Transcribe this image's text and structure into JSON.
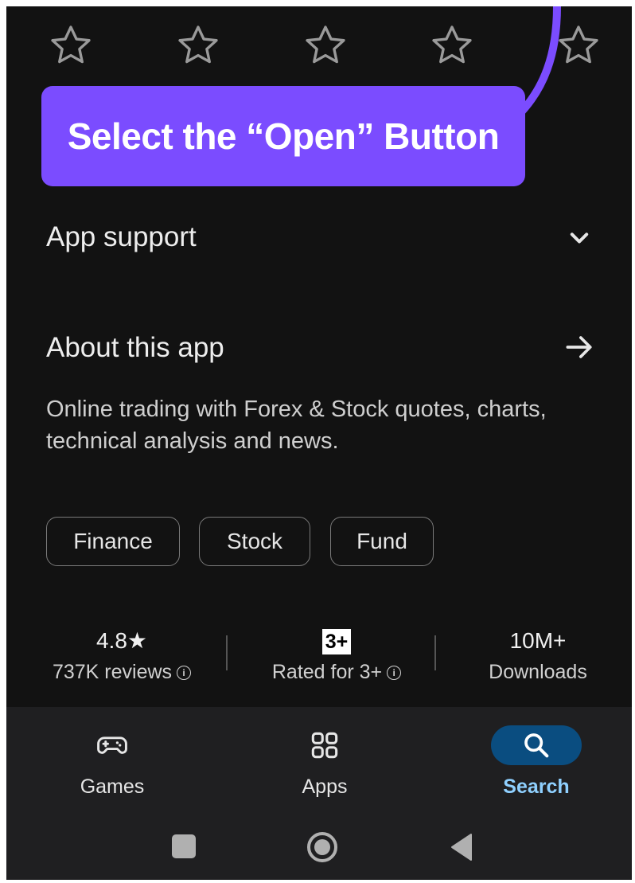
{
  "rating_prompt": {
    "star_count": 5,
    "icon": "star-outline-icon"
  },
  "callout": {
    "text": "Select the “Open” Button",
    "color": "#7b4cff"
  },
  "app_support": {
    "title": "App support",
    "icon": "chevron-down-icon"
  },
  "about": {
    "title": "About this app",
    "icon": "arrow-right-icon",
    "description": "Online trading with Forex & Stock quotes, charts, technical analysis and news."
  },
  "tags": [
    "Finance",
    "Stock",
    "Fund"
  ],
  "stats": {
    "rating": {
      "value": "4.8★",
      "label": "737K reviews"
    },
    "content_rating": {
      "badge": "3+",
      "label": "Rated for 3+"
    },
    "downloads": {
      "value": "10M+",
      "label": "Downloads"
    }
  },
  "bottom_nav": {
    "items": [
      {
        "label": "Games",
        "icon": "gamepad-icon",
        "active": false
      },
      {
        "label": "Apps",
        "icon": "apps-grid-icon",
        "active": false
      },
      {
        "label": "Search",
        "icon": "search-icon",
        "active": true
      }
    ],
    "active_color": "#8fd0ff",
    "active_pill_color": "#0a4d80"
  },
  "system_nav": [
    "recents-square-icon",
    "home-circle-icon",
    "back-triangle-icon"
  ]
}
